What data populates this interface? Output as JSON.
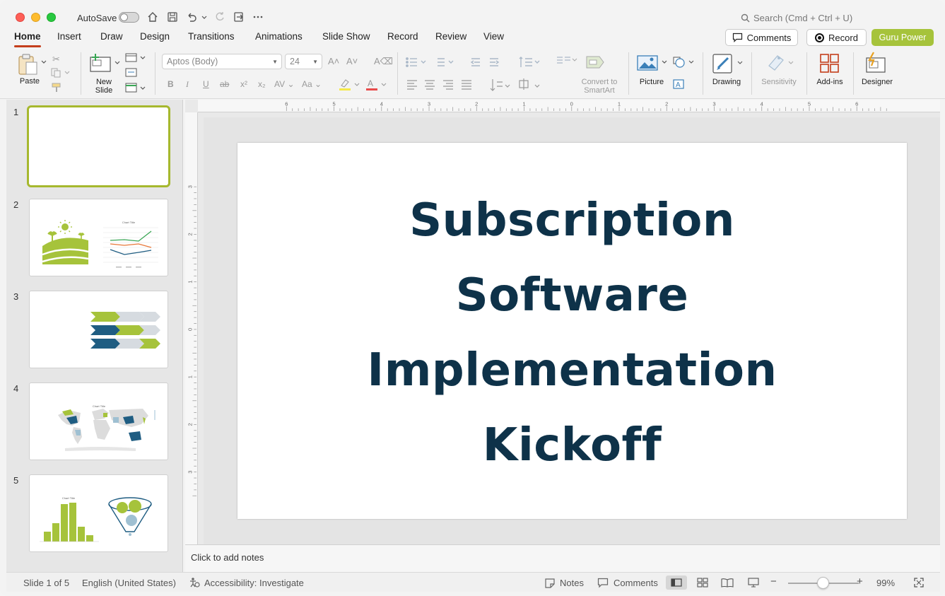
{
  "titlebar": {
    "autosave_label": "AutoSave",
    "search_placeholder": "Search (Cmd + Ctrl + U)"
  },
  "tabs": {
    "items": [
      "Home",
      "Insert",
      "Draw",
      "Design",
      "Transitions",
      "Animations",
      "Slide Show",
      "Record",
      "Review",
      "View"
    ],
    "active": "Home",
    "comments_label": "Comments",
    "record_label": "Record",
    "guru_label": "Guru Power"
  },
  "ribbon": {
    "paste_label": "Paste",
    "new_slide_label": "New Slide",
    "font_name": "Aptos (Body)",
    "font_size": "24",
    "convert_smartart_label": "Convert to SmartArt",
    "picture_label": "Picture",
    "drawing_label": "Drawing",
    "sensitivity_label": "Sensitivity",
    "addins_label": "Add-ins",
    "designer_label": "Designer",
    "colors": {
      "highlight": "#f5e94a",
      "font_color": "#e84b4b",
      "accent": "#c43e1c",
      "guru": "#a6c33b"
    }
  },
  "ruler": {
    "top_labels": [
      "6",
      "5",
      "4",
      "3",
      "2",
      "1",
      "0",
      "1",
      "2",
      "3",
      "4",
      "5",
      "6"
    ],
    "left_labels": [
      "3",
      "2",
      "1",
      "0",
      "1",
      "2",
      "3"
    ]
  },
  "thumbnails": {
    "numbers": [
      "1",
      "2",
      "3",
      "4",
      "5"
    ],
    "chart_title": "Chart Title"
  },
  "slide": {
    "title_lines": [
      "Subscription",
      "Software",
      "Implementation",
      "Kickoff"
    ],
    "title_color": "#0e3249"
  },
  "notes": {
    "placeholder": "Click to add notes"
  },
  "status": {
    "slide_position": "Slide 1 of 5",
    "language": "English (United States)",
    "accessibility": "Accessibility: Investigate",
    "notes_label": "Notes",
    "comments_label": "Comments",
    "zoom_level": "99%"
  }
}
